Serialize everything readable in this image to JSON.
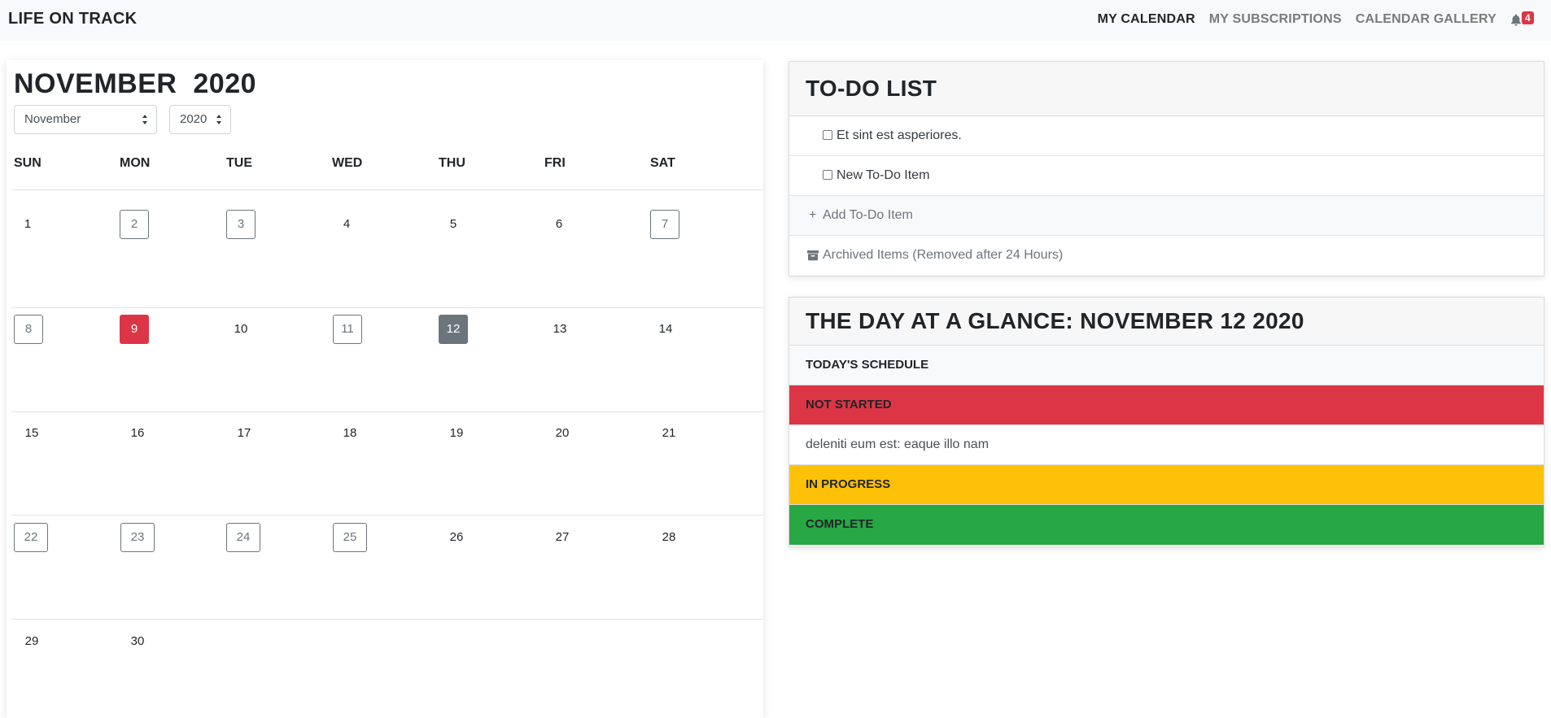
{
  "navbar": {
    "brand": "LIFE ON TRACK",
    "links": [
      "MY CALENDAR",
      "MY SUBSCRIPTIONS",
      "CALENDAR GALLERY"
    ],
    "active_link": "MY CALENDAR",
    "notification_count": "4",
    "notification_icon": "bell-icon"
  },
  "calendar": {
    "title_month": "NOVEMBER",
    "title_year": "2020",
    "month_select": "November",
    "year_select": "2020",
    "weekdays": [
      "SUN",
      "MON",
      "TUE",
      "WED",
      "THU",
      "FRI",
      "SAT"
    ],
    "weeks": [
      [
        "1",
        "2",
        "3",
        "4",
        "5",
        "6",
        "7"
      ],
      [
        "8",
        "9",
        "10",
        "11",
        "12",
        "13",
        "14"
      ],
      [
        "15",
        "16",
        "17",
        "18",
        "19",
        "20",
        "21"
      ],
      [
        "22",
        "23",
        "24",
        "25",
        "26",
        "27",
        "28"
      ],
      [
        "29",
        "30",
        "",
        "",
        "",
        "",
        ""
      ]
    ],
    "outlined_days": [
      "2",
      "3",
      "7",
      "8",
      "11",
      "22",
      "23",
      "24",
      "25"
    ],
    "highlighted_day_red": "9",
    "selected_day": "12",
    "colors": {
      "red": "#dc3545",
      "gray": "#6c757d"
    }
  },
  "todo": {
    "title": "TO-DO LIST",
    "items": [
      "Et sint est asperiores.",
      "New To-Do Item"
    ],
    "add_label": "Add To-Do Item",
    "add_icon": "plus-icon",
    "archived_label": "Archived Items (Removed after 24 Hours)",
    "archived_icon": "archive-box-icon"
  },
  "glance": {
    "title": "THE DAY AT A GLANCE: NOVEMBER 12 2020",
    "schedule_label": "TODAY'S SCHEDULE",
    "not_started_label": "NOT STARTED",
    "not_started_items": [
      "deleniti eum est: eaque illo nam"
    ],
    "in_progress_label": "IN PROGRESS",
    "complete_label": "COMPLETE",
    "colors": {
      "not_started": "#dc3545",
      "in_progress": "#ffc107",
      "complete": "#28a745"
    }
  }
}
